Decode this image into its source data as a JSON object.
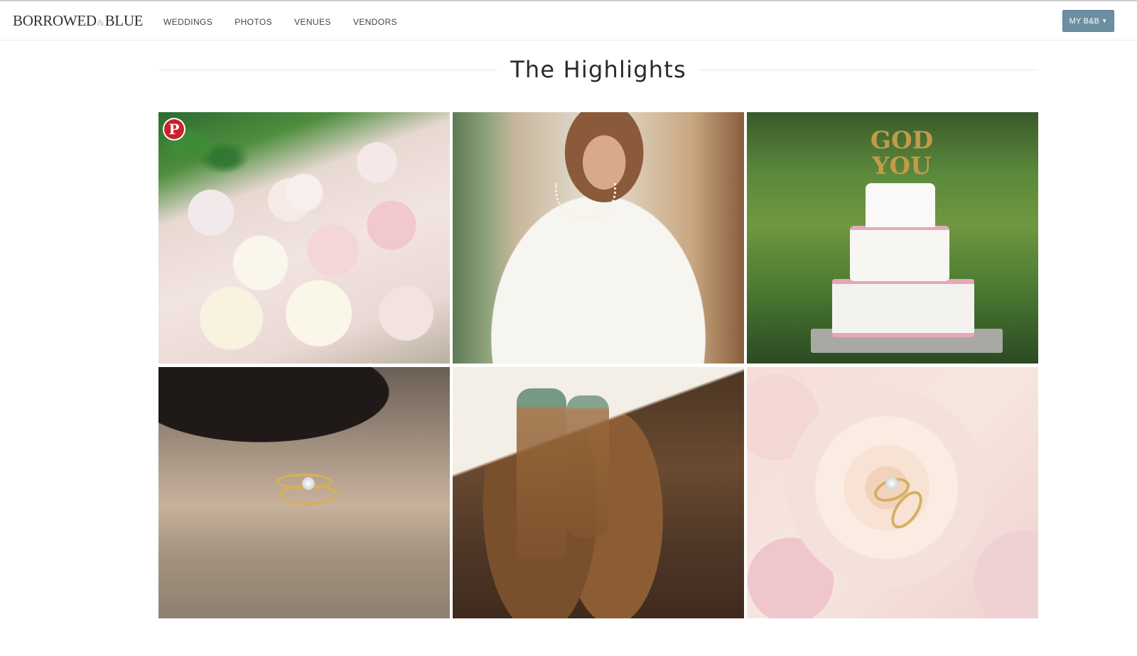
{
  "header": {
    "logo": {
      "part1": "BORROWED",
      "amp": "&",
      "part2": "BLUE"
    },
    "nav": [
      {
        "label": "WEDDINGS"
      },
      {
        "label": "PHOTOS"
      },
      {
        "label": "VENUES"
      },
      {
        "label": "VENDORS"
      }
    ],
    "account_button": {
      "label": "MY B&B",
      "icon": "chevron-down-icon"
    }
  },
  "section": {
    "title": "The Highlights"
  },
  "gallery": {
    "pin_icon": "pinterest-icon",
    "pin_glyph": "P",
    "topper_text": "GOD YOU",
    "photos": [
      {
        "subject": "bridal-bouquet"
      },
      {
        "subject": "bride-portrait"
      },
      {
        "subject": "wedding-cake"
      },
      {
        "subject": "rings-on-wood"
      },
      {
        "subject": "cowboy-boots"
      },
      {
        "subject": "rings-in-rose"
      }
    ]
  },
  "colors": {
    "accent": "#6d8fa2",
    "pinterest": "#c8232c",
    "text": "#333333"
  }
}
